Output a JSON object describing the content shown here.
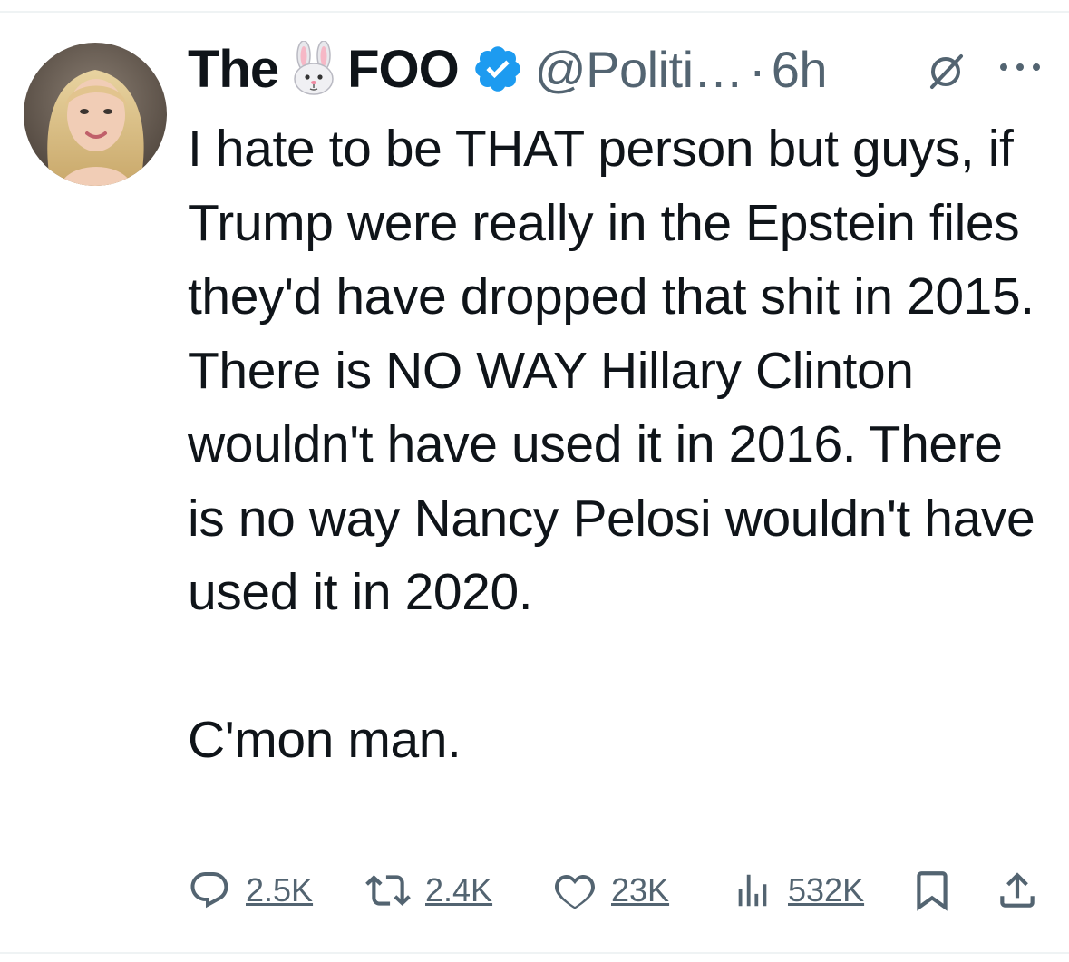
{
  "author": {
    "name_first": "The",
    "name_emoji": "rabbit-face-emoji",
    "name_last": "FOO",
    "verified": true,
    "handle": "@Politi…",
    "separator": "·",
    "time": "6h"
  },
  "tweet": {
    "text": "I hate to be THAT person but guys, if Trump were really in the Epstein files they'd have dropped that shit in 2015. There is NO WAY Hillary Clinton wouldn't have used it in 2016. There is no way Nancy Pelosi wouldn't have used it in 2020.\n\nC'mon man."
  },
  "actions": {
    "replies": "2.5K",
    "reposts": "2.4K",
    "likes": "23K",
    "views": "532K"
  },
  "colors": {
    "text": "#0f1419",
    "secondary": "#536471",
    "verified": "#1d9bf0",
    "divider": "#eff3f4"
  },
  "icons": [
    "grok-icon",
    "more-icon",
    "reply-icon",
    "retweet-icon",
    "like-icon",
    "views-icon",
    "bookmark-icon",
    "share-icon"
  ]
}
